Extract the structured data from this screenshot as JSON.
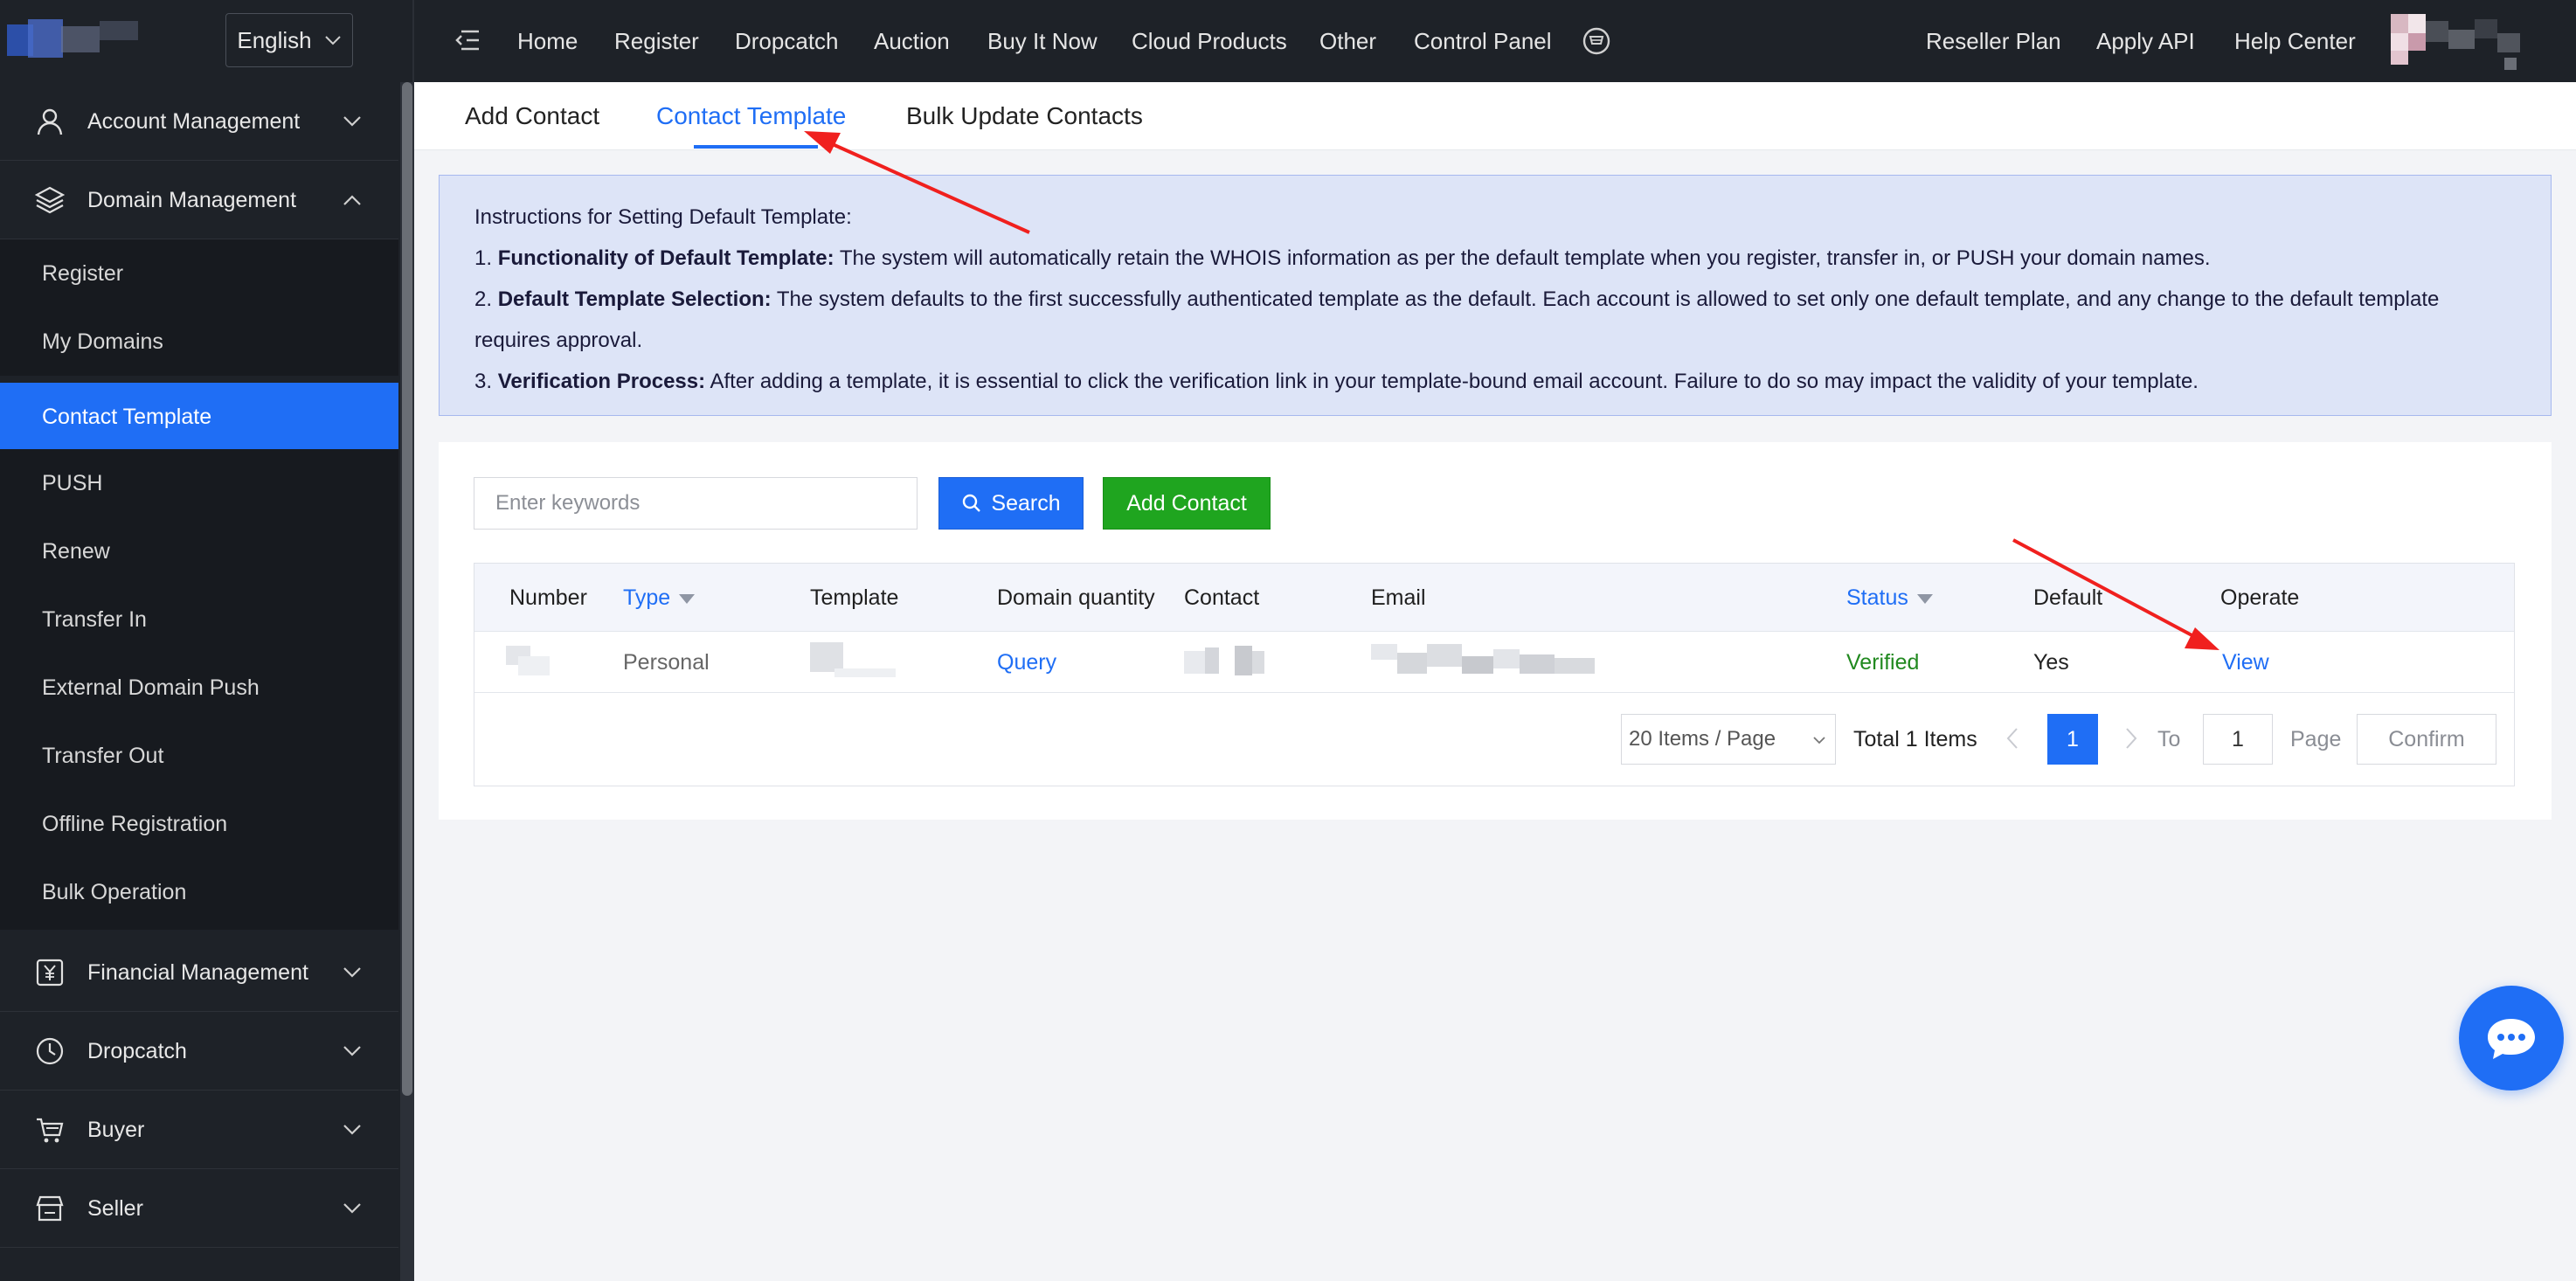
{
  "topbar": {
    "language": "English",
    "nav": [
      "Home",
      "Register",
      "Dropcatch",
      "Auction",
      "Buy It Now",
      "Cloud Products",
      "Other",
      "Control Panel"
    ],
    "right_nav": [
      "Reseller Plan",
      "Apply API",
      "Help Center"
    ]
  },
  "sidebar": {
    "groups": [
      {
        "label": "Account Management",
        "icon": "user-icon"
      },
      {
        "label": "Domain Management",
        "icon": "layers-icon"
      },
      {
        "label": "Financial Management",
        "icon": "yen-icon"
      },
      {
        "label": "Dropcatch",
        "icon": "clock-icon"
      },
      {
        "label": "Buyer",
        "icon": "cart-icon"
      },
      {
        "label": "Seller",
        "icon": "store-icon"
      }
    ],
    "items": [
      "Register",
      "My Domains",
      "Contact Template",
      "PUSH",
      "Renew",
      "Transfer In",
      "External Domain Push",
      "Transfer Out",
      "Offline Registration",
      "Bulk Operation"
    ],
    "active_item": "Contact Template"
  },
  "tabs": [
    "Add Contact",
    "Contact Template",
    "Bulk Update Contacts"
  ],
  "instructions": {
    "title": "Instructions for Setting Default Template:",
    "l1_num": "1.",
    "l1_bold": "Functionality of Default Template:",
    "l1_text": "The system will automatically retain the WHOIS information as per the default template when you register, transfer in, or PUSH your domain names.",
    "l2_num": "2.",
    "l2_bold": "Default Template Selection:",
    "l2_text": "The system defaults to the first successfully authenticated template as the default. Each account is allowed to set only one default template, and any change to the default template",
    "l2_cont": "requires approval.",
    "l3_num": "3.",
    "l3_bold": "Verification Process:",
    "l3_text": "After adding a template, it is essential to click the verification link in your template-bound email account. Failure to do so may impact the validity of your template."
  },
  "search": {
    "placeholder": "Enter keywords",
    "button": "Search",
    "add_button": "Add Contact"
  },
  "table": {
    "headers": [
      "Number",
      "Type",
      "Template",
      "Domain quantity",
      "Contact",
      "Email",
      "Status",
      "Default",
      "Operate"
    ],
    "row": {
      "type": "Personal",
      "domain_quantity": "Query",
      "status": "Verified",
      "default": "Yes",
      "operate": "View"
    }
  },
  "pagination": {
    "page_size": "20 Items / Page",
    "total": "Total 1 Items",
    "current_page": "1",
    "to_label": "To",
    "page_input": "1",
    "page_label": "Page",
    "confirm": "Confirm"
  },
  "colors": {
    "accent": "#1f6ef5",
    "success": "#1fa51f",
    "sidebar_bg": "#1e2228",
    "annotation_arrow": "#f0201e"
  }
}
